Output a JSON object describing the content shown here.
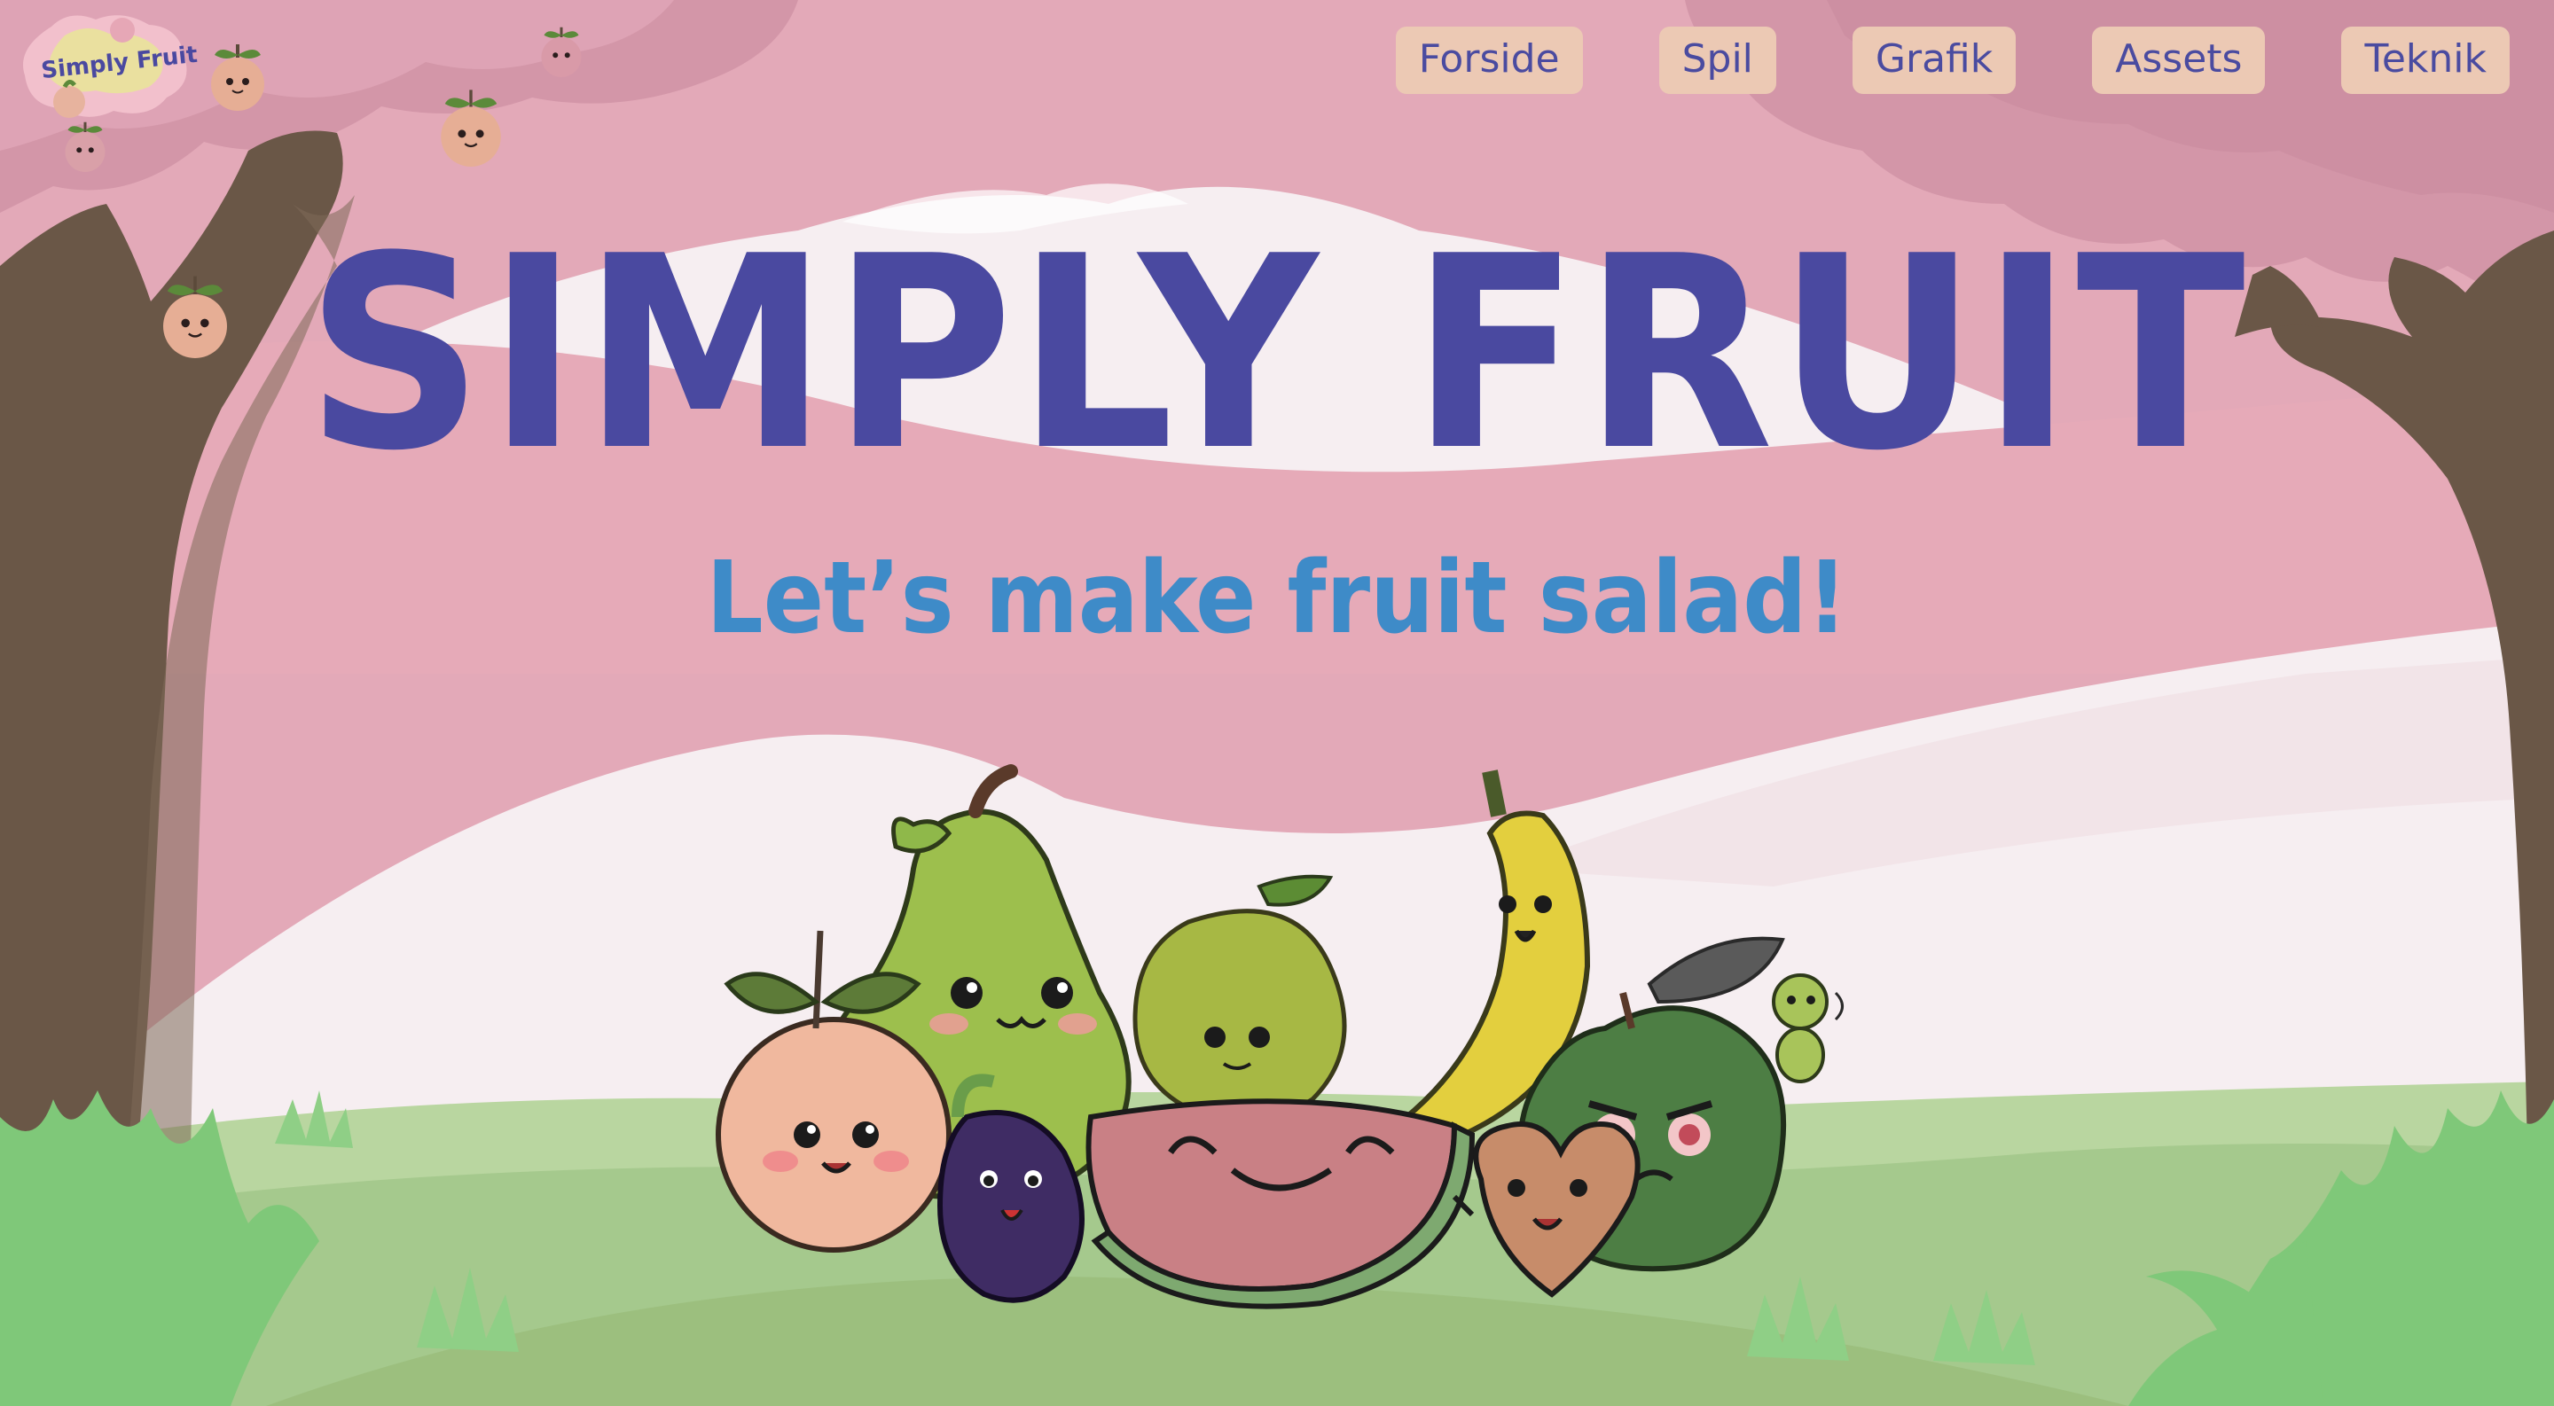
{
  "brand": {
    "logo_text": "Simply Fruit"
  },
  "nav": {
    "items": [
      {
        "label": "Forside"
      },
      {
        "label": "Spil"
      },
      {
        "label": "Grafik"
      },
      {
        "label": "Assets"
      },
      {
        "label": "Teknik"
      }
    ]
  },
  "hero": {
    "title": "SIMPLY FRUIT",
    "subtitle": "Let’s make fruit salad!"
  },
  "colors": {
    "sky": "#e3a9b8",
    "title": "#4a49a0",
    "subtitle": "#3e8bc8",
    "nav_bg": "#ecc9b4",
    "nav_text": "#4a4ba0",
    "grass": "#8fc57f",
    "trunk": "#6b5a4a"
  },
  "icons": {
    "hanging_fruit": "peach-icon",
    "characters": [
      "peach",
      "pear",
      "soursop",
      "banana",
      "green-apple",
      "worm",
      "blackberry",
      "watermelon",
      "cherry-heart"
    ]
  }
}
